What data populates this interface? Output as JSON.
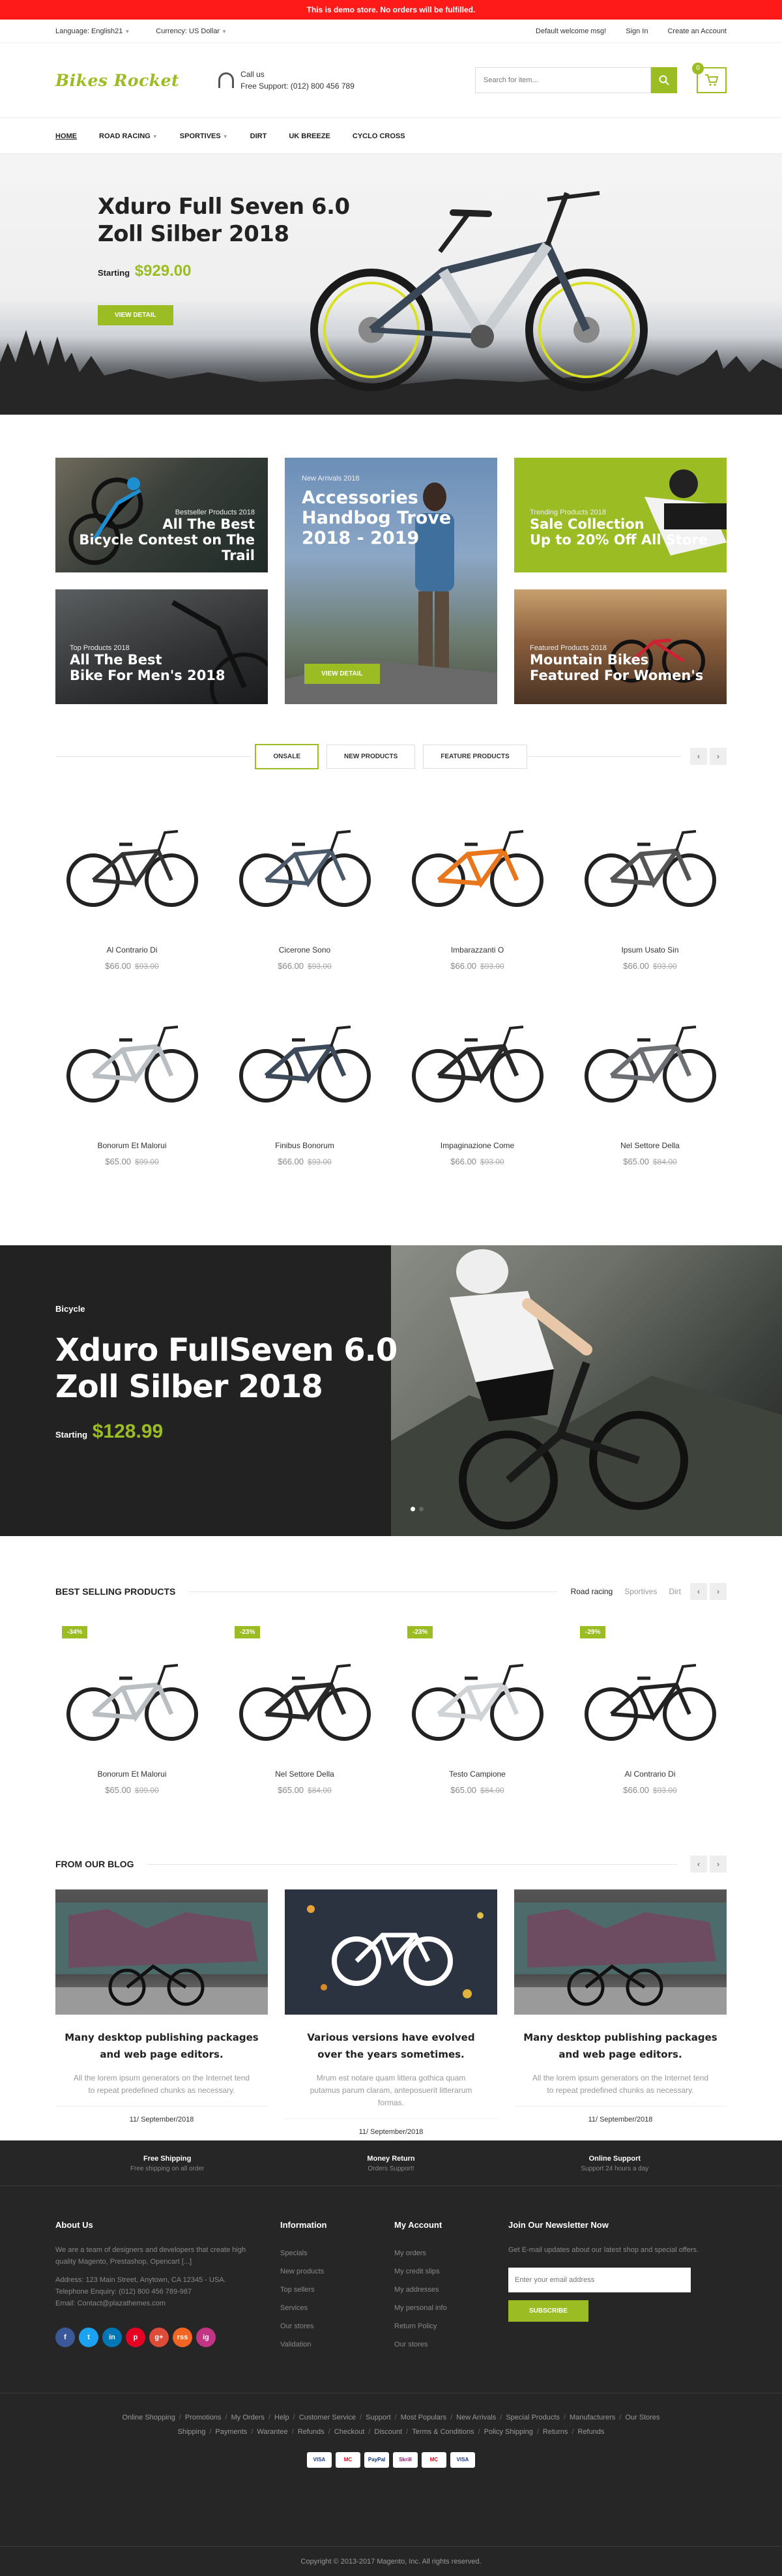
{
  "demo_notice": "This is demo store. No orders will be fulfilled.",
  "topbar": {
    "language": "Language: English21",
    "currency": "Currency: US Dollar",
    "welcome": "Default welcome msg!",
    "sign_in": "Sign In",
    "create_account": "Create an Account"
  },
  "header": {
    "logo": "Bikes Rocket",
    "call_us": "Call us",
    "support_phone": "Free Support: (012) 800 456 789",
    "search_placeholder": "Search for item...",
    "cart_count": "0"
  },
  "nav": {
    "items": [
      "Home",
      "Road racing",
      "Sportives",
      "Dirt",
      "UK Breeze",
      "Cyclo cross"
    ]
  },
  "hero": {
    "title_line1": "Xduro Full Seven 6.0",
    "title_line2": "Zoll Silber 2018",
    "starting": "Starting",
    "price": "$929.00",
    "button": "View Detail"
  },
  "banners": [
    {
      "small": "Bestseller Products 2018",
      "line1": "All The Best",
      "line2": "Bicycle Contest on The Trail"
    },
    {
      "small": "New Arrivals 2018",
      "line1": "Accessories",
      "line2": "Handbog Trove",
      "line3": "2018 - 2019",
      "button": "View Detail"
    },
    {
      "small": "Trending Products 2018",
      "line1": "Sale Collection",
      "line2": "Up to 20% Off All Store"
    },
    {
      "small": "Top Products 2018",
      "line1": "All The Best",
      "line2": "Bike For Men's 2018"
    },
    {
      "small": "Featured Products 2018",
      "line1": "Mountain Bikes",
      "line2": "Featured For Women's"
    }
  ],
  "tabs": [
    "Onsale",
    "New Products",
    "Feature Products"
  ],
  "products": [
    {
      "name": "Al Contrario Di",
      "price": "$66.00",
      "old": "$93.00"
    },
    {
      "name": "Cicerone Sono",
      "price": "$66.00",
      "old": "$93.00"
    },
    {
      "name": "Imbarazzanti O",
      "price": "$66.00",
      "old": "$93.00"
    },
    {
      "name": "Ipsum Usato Sin",
      "price": "$66.00",
      "old": "$93.00"
    },
    {
      "name": "Bonorum Et Malorui",
      "price": "$65.00",
      "old": "$99.00"
    },
    {
      "name": "Finibus Bonorum",
      "price": "$66.00",
      "old": "$93.00"
    },
    {
      "name": "Impaginazione Come",
      "price": "$66.00",
      "old": "$93.00"
    },
    {
      "name": "Nel Settore Della",
      "price": "$65.00",
      "old": "$84.00"
    }
  ],
  "promo": {
    "eyebrow": "Bicycle",
    "title_line1": "Xduro FullSeven 6.0",
    "title_line2": "Zoll Silber 2018",
    "starting": "Starting",
    "price": "$128.99"
  },
  "best_selling": {
    "title": "Best Selling Products",
    "categories": [
      "Road racing",
      "Sportives",
      "Dirt"
    ],
    "items": [
      {
        "badge": "-34%",
        "name": "Bonorum Et Malorui",
        "price": "$65.00",
        "old": "$99.00"
      },
      {
        "badge": "-23%",
        "name": "Nel Settore Della",
        "price": "$65.00",
        "old": "$84.00"
      },
      {
        "badge": "-23%",
        "name": "Testo Campione",
        "price": "$65.00",
        "old": "$84.00"
      },
      {
        "badge": "-29%",
        "name": "Al Contrario Di",
        "price": "$66.00",
        "old": "$93.00"
      }
    ]
  },
  "blog": {
    "title": "From Our Blog",
    "posts": [
      {
        "title": "Many desktop publishing packages and web page editors.",
        "body": "All the lorem ipsum generators on the Internet tend to repeat predefined chunks as necessary.",
        "date": "11/ September/2018"
      },
      {
        "title": "Various versions have evolved over the years sometimes.",
        "body": "Mrum est notare quam littera gothica quam putamus parum claram, anteposuerit litterarum formas.",
        "date": "11/ September/2018"
      },
      {
        "title": "Many desktop publishing packages and web page editors.",
        "body": "All the lorem ipsum generators on the Internet tend to repeat predefined chunks as necessary.",
        "date": "11/ September/2018"
      }
    ]
  },
  "services": [
    {
      "title": "Free Shipping",
      "sub": "Free shipping on all order"
    },
    {
      "title": "Money Return",
      "sub": "Orders Support!"
    },
    {
      "title": "Online Support",
      "sub": "Support 24 hours a day"
    }
  ],
  "footer": {
    "about_title": "About Us",
    "about_text": "We are a team of designers and developers that create high quality Magento, Prestashop, Opencart [...]",
    "address": "Address: 123 Main Street, Anytown, CA 12345 - USA.",
    "phone": "Telephone Enquiry: (012) 800 456 789-987",
    "email": "Email: Contact@plazathemes.com",
    "socials": [
      "f",
      "t",
      "in",
      "p",
      "g+",
      "rss",
      "ig"
    ],
    "info_title": "Information",
    "info_links": [
      "Specials",
      "New products",
      "Top sellers",
      "Services",
      "Our stores",
      "Validation"
    ],
    "account_title": "My Account",
    "account_links": [
      "My orders",
      "My credit slips",
      "My addresses",
      "My personal info",
      "Return Policy",
      "Our stores"
    ],
    "newsletter_title": "Join Our Newsletter Now",
    "newsletter_text": "Get E-mail updates about our latest shop and special offers.",
    "newsletter_placeholder": "Enter your email address",
    "subscribe": "Subscribe",
    "links_row1": [
      "Online Shopping",
      "Promotions",
      "My Orders",
      "Help",
      "Customer Service",
      "Support",
      "Most Populars",
      "New Arrivals",
      "Special Products",
      "Manufacturers",
      "Our Stores"
    ],
    "links_row2": [
      "Shipping",
      "Payments",
      "Warantee",
      "Refunds",
      "Checkout",
      "Discount",
      "Terms & Conditions",
      "Policy Shipping",
      "Returns",
      "Refunds"
    ],
    "payments": [
      "VISA",
      "MC",
      "PayPal",
      "Skrill",
      "MC",
      "VISA"
    ],
    "copyright": "Copyright © 2013-2017 Magento, Inc. All rights reserved."
  },
  "colors": {
    "accent": "#9cbc23",
    "demo_bar": "#ff1a1a",
    "footer_bg": "#262626"
  }
}
